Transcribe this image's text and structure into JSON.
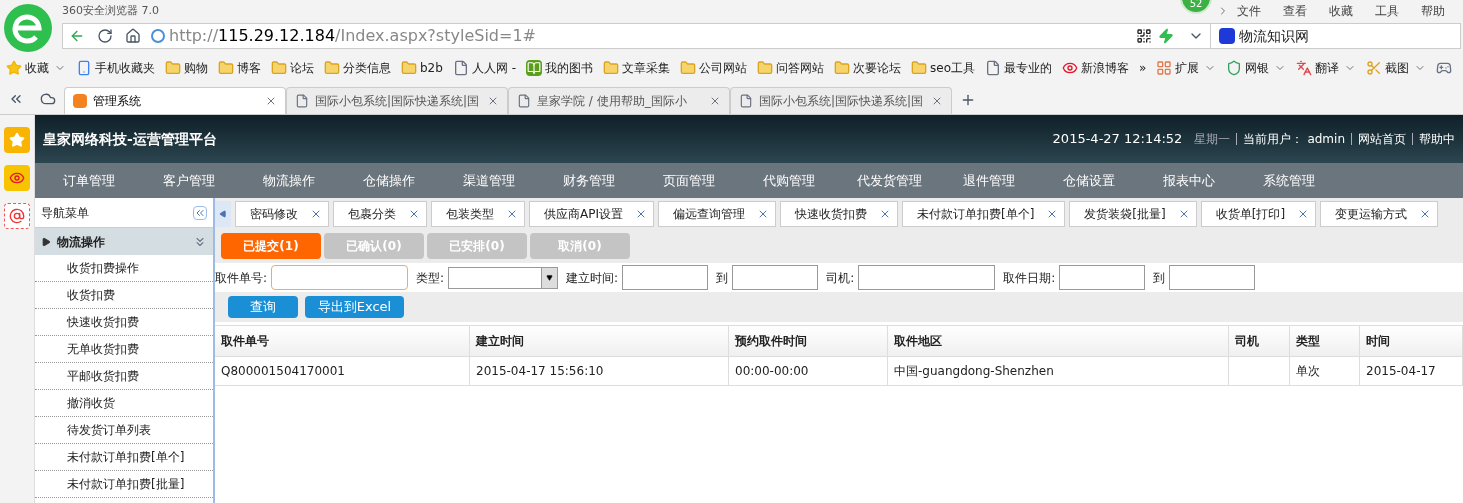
{
  "browser": {
    "title": "360安全浏览器 7.0",
    "badge": "52",
    "menu": [
      "文件",
      "查看",
      "收藏",
      "工具",
      "帮助"
    ],
    "url": {
      "scheme": "http://",
      "host": "115.29.12.184",
      "path": "/Index.aspx?styleSid=1#"
    },
    "search": {
      "value": "物流知识网"
    },
    "bookmarks": [
      {
        "kind": "star",
        "label": "收藏",
        "dropdown": true
      },
      {
        "kind": "phone",
        "label": "手机收藏夹",
        "dropdown": false
      },
      {
        "kind": "folder",
        "label": "购物",
        "dropdown": false
      },
      {
        "kind": "folder",
        "label": "博客",
        "dropdown": false
      },
      {
        "kind": "folder",
        "label": "论坛",
        "dropdown": false
      },
      {
        "kind": "folder",
        "label": "分类信息",
        "dropdown": false
      },
      {
        "kind": "folder",
        "label": "b2b",
        "dropdown": false
      },
      {
        "kind": "page",
        "label": "人人网 -",
        "dropdown": false
      },
      {
        "kind": "book",
        "label": "我的图书",
        "dropdown": false
      },
      {
        "kind": "folder",
        "label": "文章采集",
        "dropdown": false
      },
      {
        "kind": "folder",
        "label": "公司网站",
        "dropdown": false
      },
      {
        "kind": "folder",
        "label": "问答网站",
        "dropdown": false
      },
      {
        "kind": "folder",
        "label": "次要论坛",
        "dropdown": false
      },
      {
        "kind": "folder",
        "label": "seo工具",
        "dropdown": false
      },
      {
        "kind": "page",
        "label": "最专业的",
        "dropdown": false
      },
      {
        "kind": "weibo",
        "label": "新浪博客",
        "dropdown": false
      },
      {
        "kind": "more",
        "label": "»",
        "dropdown": false
      },
      {
        "kind": "grid",
        "label": "扩展",
        "dropdown": true
      },
      {
        "kind": "shield",
        "label": "网银",
        "dropdown": true
      },
      {
        "kind": "translate",
        "label": "翻译",
        "dropdown": true
      },
      {
        "kind": "scissors",
        "label": "截图",
        "dropdown": true
      },
      {
        "kind": "game",
        "dropdown": false
      }
    ],
    "tabs": [
      {
        "label": "管理系统",
        "selected": true
      },
      {
        "label": "国际小包系统|国际快递系统|国",
        "selected": false
      },
      {
        "label": "皇家学院 / 使用帮助_国际小",
        "selected": false
      },
      {
        "label": "国际小包系统|国际快递系统|国",
        "selected": false
      }
    ]
  },
  "app": {
    "title": "皇家网络科技-运营管理平台",
    "header_info": {
      "datetime": "2015-4-27 12:14:52",
      "weekday": "星期一",
      "user_label": "当前用户：",
      "user": "admin",
      "links": [
        "网站首页",
        "帮助中"
      ]
    },
    "menu": [
      "订单管理",
      "客户管理",
      "物流操作",
      "仓储操作",
      "渠道管理",
      "财务管理",
      "页面管理",
      "代购管理",
      "代发货管理",
      "退件管理",
      "仓储设置",
      "报表中心",
      "系统管理"
    ],
    "nav": {
      "title": "导航菜单",
      "section": {
        "label": "物流操作",
        "expanded": true,
        "items": [
          "收货扣费操作",
          "收货扣费",
          "快速收货扣费",
          "无单收货扣费",
          "平邮收货扣费",
          "撤消收货",
          "待发货订单列表",
          "未付款订单扣费[单个]",
          "未付款订单扣费[批量]"
        ]
      }
    },
    "page_tabs": [
      "密码修改",
      "包裹分类",
      "包装类型",
      "供应商API设置",
      "偏远查询管理",
      "快速收货扣费",
      "未付款订单扣费[单个]",
      "发货装袋[批量]",
      "收货单[打印]",
      "变更运输方式"
    ],
    "status_tabs": [
      {
        "label": "已提交(1)",
        "selected": true
      },
      {
        "label": "已确认(0)",
        "selected": false
      },
      {
        "label": "已安排(0)",
        "selected": false
      },
      {
        "label": "取消(0)",
        "selected": false
      }
    ],
    "filters": [
      {
        "kind": "text",
        "label": "取件单号:",
        "focused": true
      },
      {
        "kind": "select",
        "label": "类型:",
        "focused": false
      },
      {
        "kind": "text",
        "label": "建立时间:",
        "focused": false
      },
      {
        "kind": "text",
        "label": "到",
        "focused": false
      },
      {
        "kind": "wide",
        "label": "司机:",
        "focused": false
      },
      {
        "kind": "text",
        "label": "取件日期:",
        "focused": false
      },
      {
        "kind": "text",
        "label": "到",
        "focused": false
      }
    ],
    "buttons": [
      "查询",
      "导出到Excel"
    ],
    "table": {
      "columns": [
        "取件单号",
        "建立时间",
        "预约取件时间",
        "取件地区",
        "司机",
        "类型",
        "时间"
      ],
      "rows": [
        [
          "Q800001504170001",
          "2015-04-17 15:56:10",
          "00:00-00:00",
          "中国-guangdong-Shenzhen",
          "",
          "单次",
          "2015-04-17"
        ]
      ]
    }
  }
}
